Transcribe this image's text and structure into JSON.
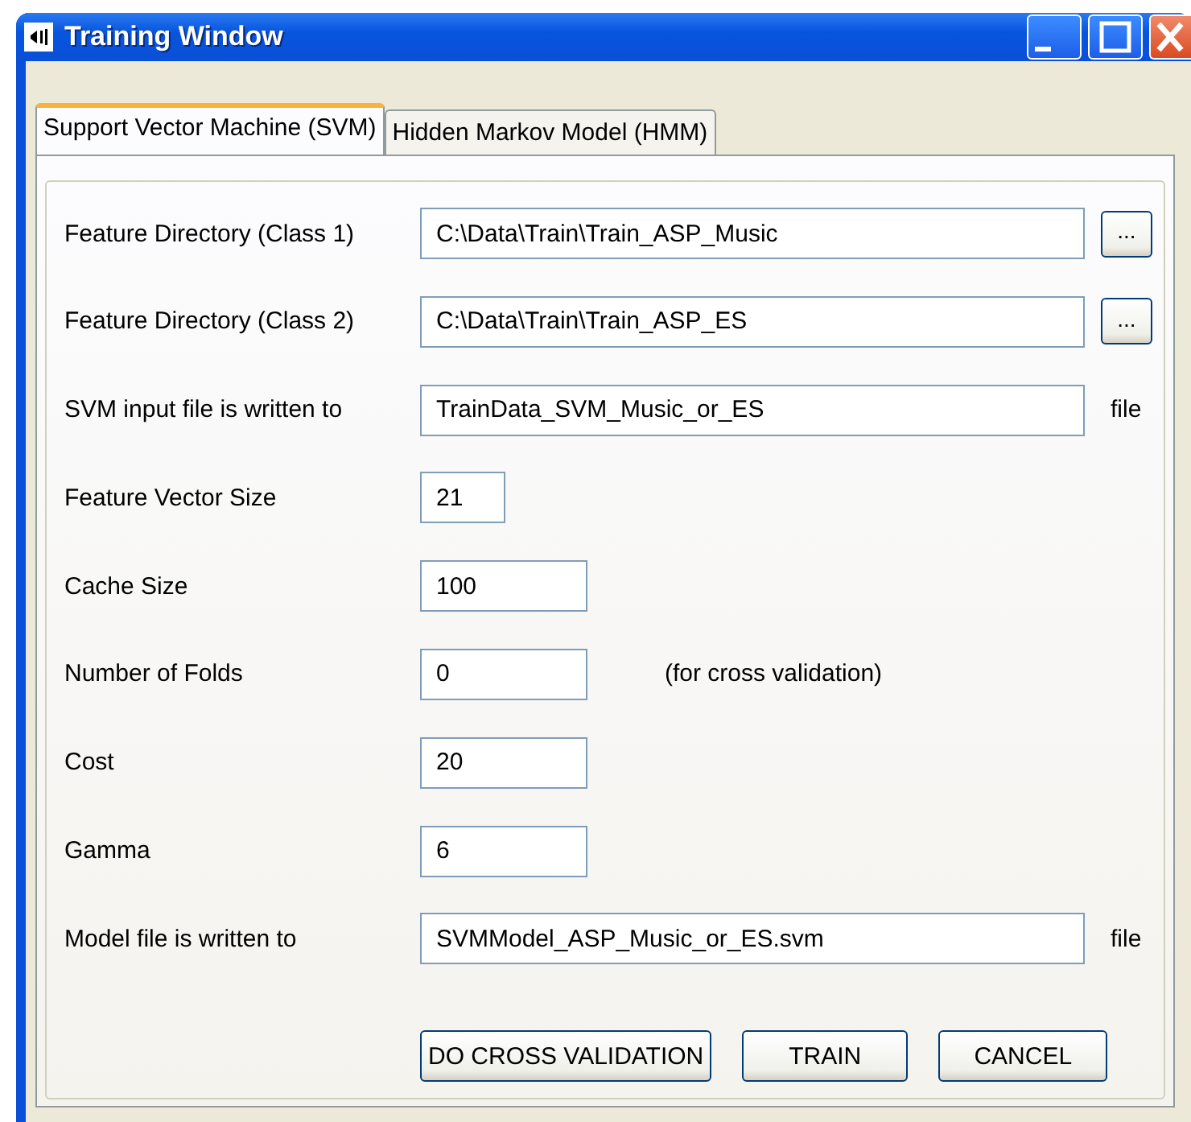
{
  "window": {
    "title": "Training Window"
  },
  "tabs": [
    {
      "label": "Support Vector Machine (SVM)",
      "selected": true
    },
    {
      "label": "Hidden Markov Model (HMM)",
      "selected": false
    }
  ],
  "rows": [
    {
      "kind": "path",
      "label": "Feature Directory (Class 1)",
      "value": "C:\\Data\\Train\\Train_ASP_Music",
      "button": "..."
    },
    {
      "kind": "path",
      "label": "Feature Directory (Class 2)",
      "value": "C:\\Data\\Train\\Train_ASP_ES",
      "button": "..."
    },
    {
      "kind": "file",
      "label": "SVM input file is written to",
      "value": "TrainData_SVM_Music_or_ES",
      "suffix": "file"
    },
    {
      "kind": "tiny",
      "label": "Feature Vector Size",
      "value": "21"
    },
    {
      "kind": "short",
      "label": "Cache Size",
      "value": "100"
    },
    {
      "kind": "short",
      "label": "Number of Folds",
      "value": "0",
      "note": "(for cross validation)"
    },
    {
      "kind": "short",
      "label": "Cost",
      "value": "20"
    },
    {
      "kind": "short",
      "label": "Gamma",
      "value": "6"
    },
    {
      "kind": "file",
      "label": "Model file is written to",
      "value": "SVMModel_ASP_Music_or_ES.svm",
      "suffix": "file"
    }
  ],
  "buttons": [
    "DO CROSS VALIDATION",
    "TRAIN",
    "CANCEL"
  ]
}
